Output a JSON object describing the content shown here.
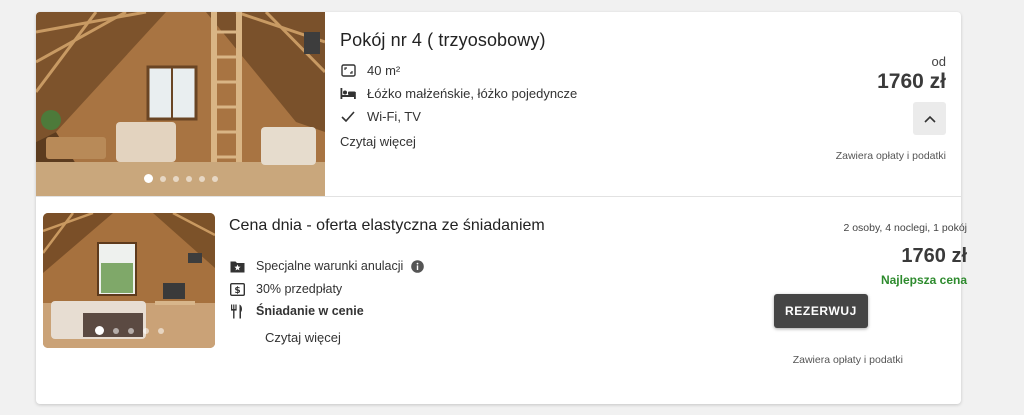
{
  "room": {
    "title": "Pokój nr 4 ( trzyosobowy)",
    "features": [
      {
        "icon": "area-icon",
        "text": "40 m²"
      },
      {
        "icon": "bed-icon",
        "text": "Łóżko małżeńskie, łóżko pojedyncze"
      },
      {
        "icon": "check-icon",
        "text": "Wi-Fi, TV"
      }
    ],
    "read_more": "Czytaj więcej",
    "from_label": "od",
    "price": "1760 zł",
    "fees_note": "Zawiera opłaty i podatki",
    "photo_dots": 6,
    "active_dot": 1
  },
  "offer": {
    "title": "Cena dnia - oferta elastyczna ze śniadaniem",
    "features": [
      {
        "icon": "star-folder-icon",
        "text": "Specjalne warunki anulacji"
      },
      {
        "icon": "dollar-icon",
        "text": "30% przedpłaty"
      },
      {
        "icon": "cutlery-icon",
        "text": "Śniadanie w cenie"
      }
    ],
    "read_more": "Czytaj więcej",
    "guests_summary": "2 osoby, 4 noclegi, 1 pokój",
    "price": "1760 zł",
    "best_price": "Najlepsza cena",
    "reserve_label": "REZERWUJ",
    "fees_note": "Zawiera opłaty i podatki",
    "photo_dots": 5,
    "active_dot": 1
  },
  "colors": {
    "best_price": "#2e8b2e",
    "reserve_button": "#454545",
    "card_bg": "#ffffff",
    "page_bg": "#f1f1f1"
  }
}
